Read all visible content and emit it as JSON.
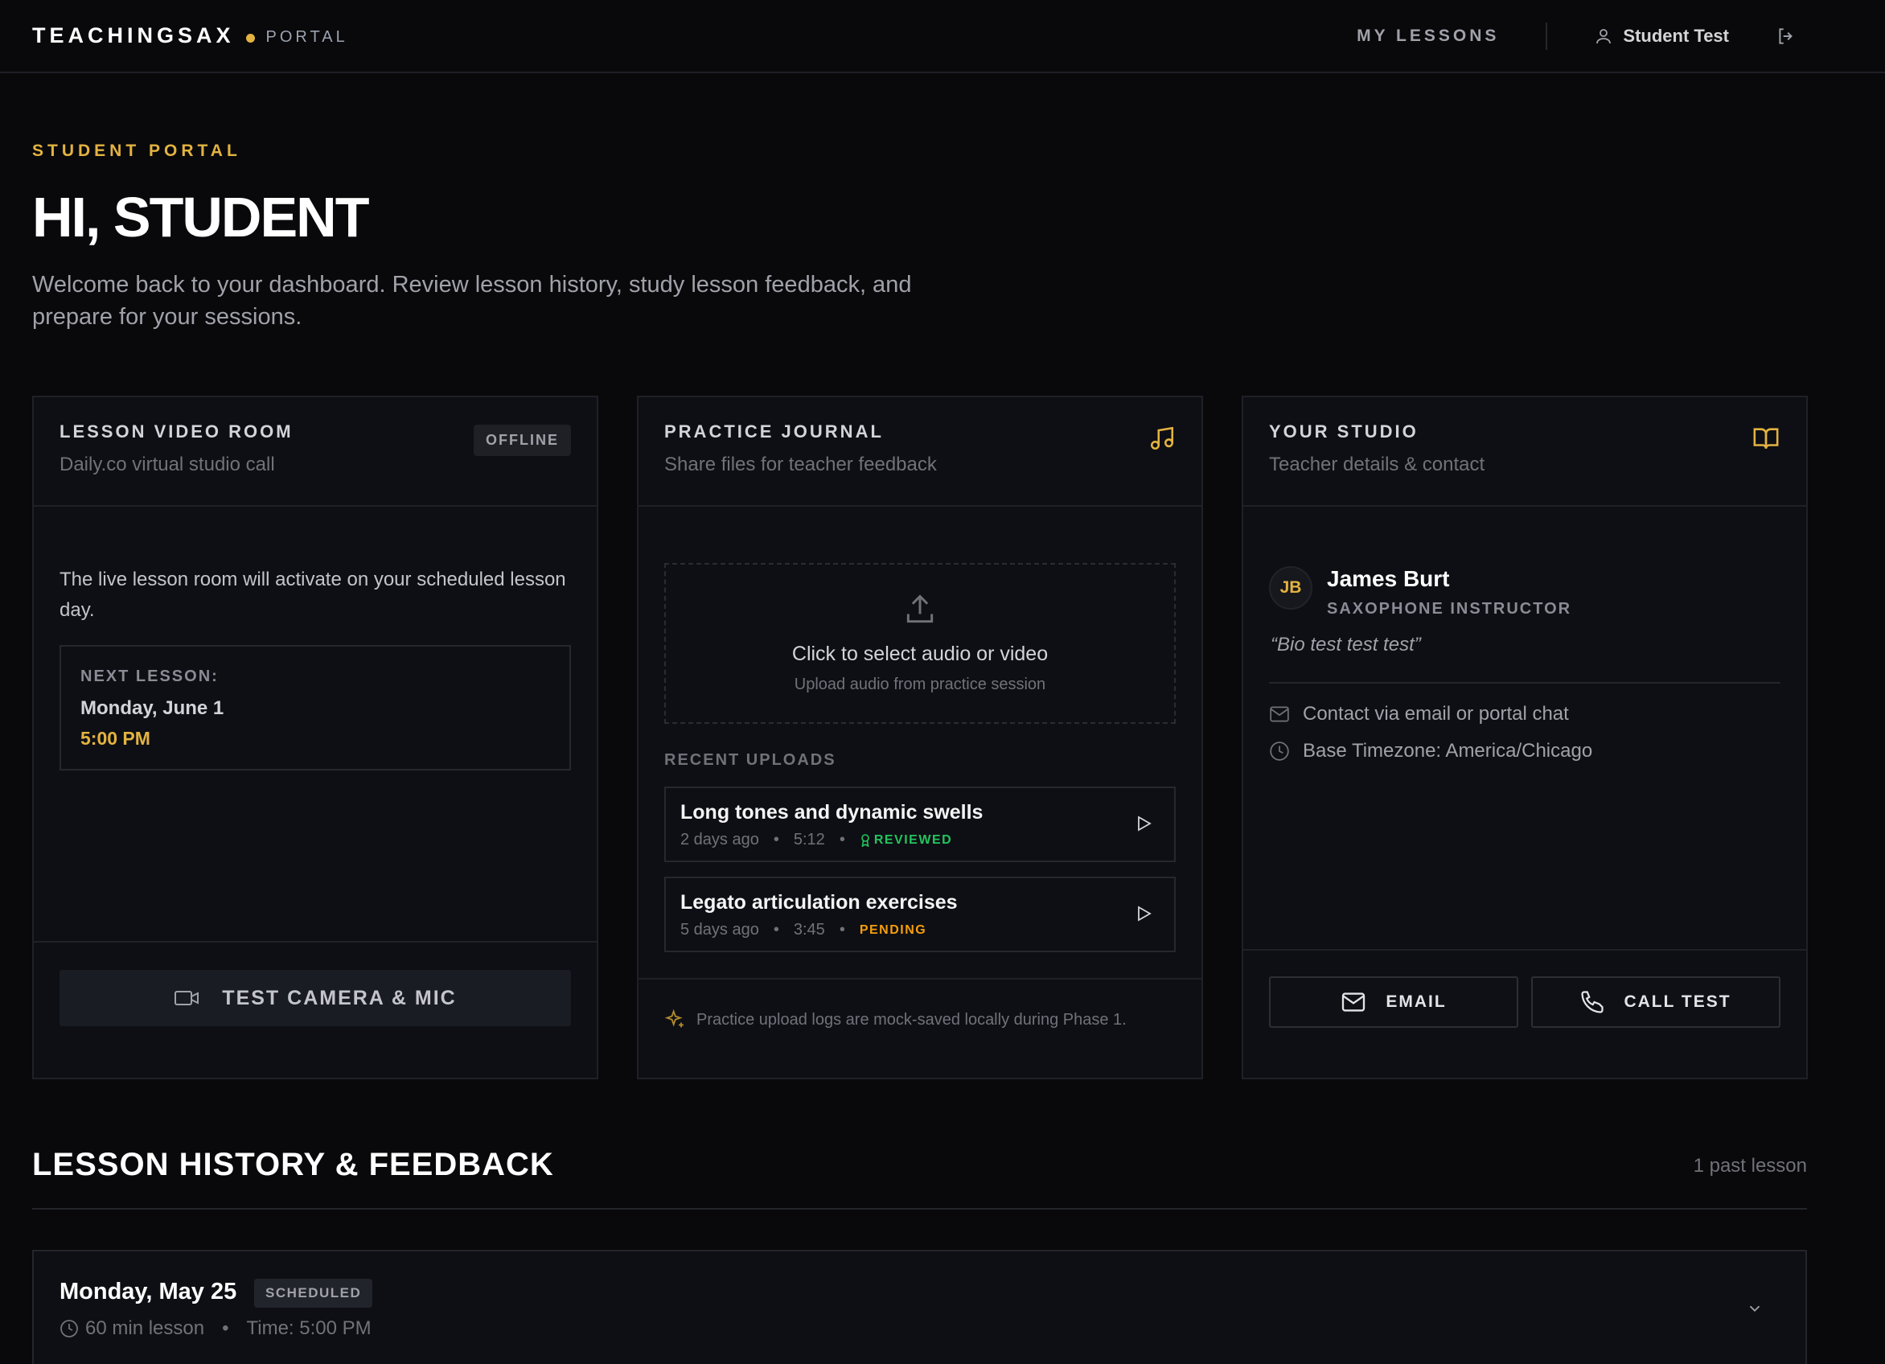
{
  "header": {
    "brand": "TEACHINGSAX",
    "brand_sub": "PORTAL",
    "nav_my_lessons": "MY LESSONS",
    "user_name": "Student Test"
  },
  "hero": {
    "eyebrow": "STUDENT PORTAL",
    "title": "HI, STUDENT",
    "subtitle": "Welcome back to your dashboard. Review lesson history, study lesson feedback, and prepare for your sessions."
  },
  "video_room": {
    "title": "LESSON VIDEO ROOM",
    "subtitle": "Daily.co virtual studio call",
    "status": "OFFLINE",
    "message": "The live lesson room will activate on your scheduled lesson day.",
    "next_label": "NEXT LESSON:",
    "next_day": "Monday, June 1",
    "next_time": "5:00 PM",
    "test_button": "TEST CAMERA & MIC"
  },
  "journal": {
    "title": "PRACTICE JOURNAL",
    "subtitle": "Share files for teacher feedback",
    "drop_main": "Click to select audio or video",
    "drop_sub": "Upload audio from practice session",
    "recent_label": "RECENT UPLOADS",
    "uploads": [
      {
        "title": "Long tones and dynamic swells",
        "when": "2 days ago",
        "duration": "5:12",
        "status": "REVIEWED"
      },
      {
        "title": "Legato articulation exercises",
        "when": "5 days ago",
        "duration": "3:45",
        "status": "PENDING"
      }
    ],
    "note": "Practice upload logs are mock-saved locally during Phase 1."
  },
  "studio": {
    "title": "YOUR STUDIO",
    "subtitle": "Teacher details & contact",
    "initials": "JB",
    "teacher_name": "James Burt",
    "teacher_role": "SAXOPHONE INSTRUCTOR",
    "bio": "“Bio test test test”",
    "contact": "Contact via email or portal chat",
    "timezone": "Base Timezone: America/Chicago",
    "email_button": "EMAIL",
    "call_button": "CALL TEST"
  },
  "history": {
    "title": "LESSON HISTORY & FEEDBACK",
    "count": "1 past lesson",
    "lessons": [
      {
        "date": "Monday, May 25",
        "status": "SCHEDULED",
        "length": "60 min lesson",
        "time": "Time: 5:00 PM"
      }
    ]
  },
  "colors": {
    "accent": "#e3b341",
    "reviewed": "#22c55e",
    "pending": "#f59e0b",
    "background": "#09090b",
    "card": "#0e0f14"
  }
}
